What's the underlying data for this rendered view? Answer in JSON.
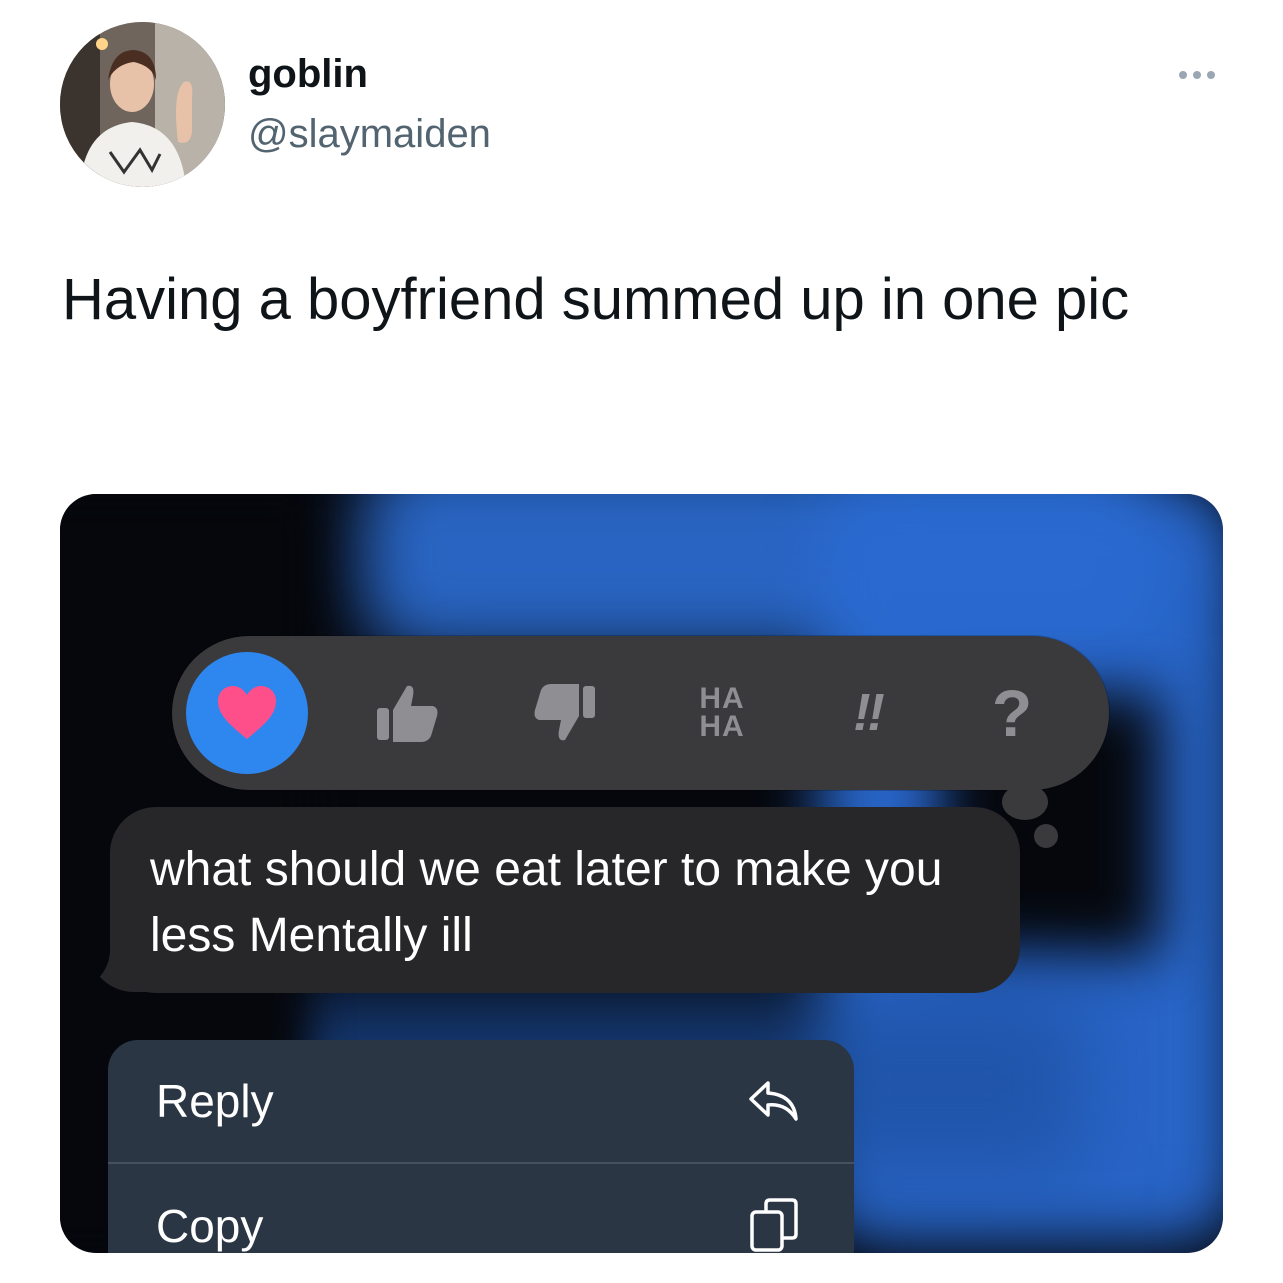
{
  "tweet": {
    "display_name": "goblin",
    "handle": "@slaymaiden",
    "text": "Having a boyfriend summed up in one pic"
  },
  "screenshot": {
    "tapbacks": [
      {
        "name": "heart",
        "icon": "heart-icon",
        "selected": true
      },
      {
        "name": "like",
        "icon": "thumbs-up-icon"
      },
      {
        "name": "dislike",
        "icon": "thumbs-down-icon"
      },
      {
        "name": "haha",
        "label_top": "HA",
        "label_bottom": "HA"
      },
      {
        "name": "emphasize",
        "label": "‼"
      },
      {
        "name": "question",
        "label": "?"
      }
    ],
    "message": "what should we eat later to make you less Mentally ill",
    "menu": [
      {
        "label": "Reply",
        "icon": "reply-icon"
      },
      {
        "label": "Copy",
        "icon": "copy-icon"
      }
    ]
  },
  "colors": {
    "heart": "#ff4f8b",
    "heart_bg": "#2e86ef",
    "bubble": "#27272a",
    "accent_blue": "#2a6ad1"
  }
}
